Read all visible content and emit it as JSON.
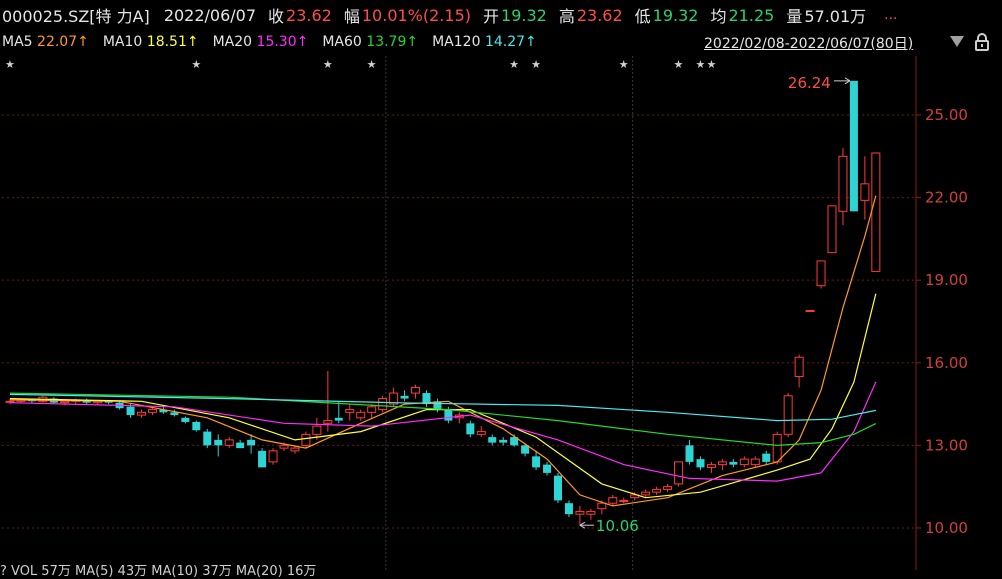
{
  "header": {
    "symbol": "000025.SZ[特 力A]",
    "date": "2022/06/07",
    "close_label": "收",
    "close_value": "23.62",
    "change_label": "幅",
    "change_value": "10.01%(2.15)",
    "open_label": "开",
    "open_value": "19.32",
    "high_label": "高",
    "high_value": "23.62",
    "low_label": "低",
    "low_value": "19.32",
    "avg_label": "均",
    "avg_value": "21.25",
    "volume_label": "量",
    "volume_value": "57.01万",
    "more": "..."
  },
  "ma_legend": [
    {
      "label": "MA5",
      "value": "22.07↑",
      "color": "#ff9a1e"
    },
    {
      "label": "MA10",
      "value": "18.51↑",
      "color": "#ffff3c"
    },
    {
      "label": "MA20",
      "value": "15.30↑",
      "color": "#ff2bff"
    },
    {
      "label": "MA60",
      "value": "13.79↑",
      "color": "#26d826"
    },
    {
      "label": "MA120",
      "value": "14.27↑",
      "color": "#4ce6f0"
    }
  ],
  "date_range": "2022/02/08-2022/06/07(80日)",
  "y_ticks": [
    "25.00",
    "22.00",
    "19.00",
    "16.00",
    "13.00",
    "10.00"
  ],
  "annotations": {
    "high_label": "26.24",
    "low_label": "10.06"
  },
  "volume_bar": {
    "text": "? VOL 57万 MA(5) 43万 MA(10) 37万 MA(20) 16万"
  },
  "colors": {
    "up": "#ff3b3b",
    "down": "#2ed4d4",
    "background": "#000000",
    "grid": "#6b1a1a"
  },
  "chart_data": {
    "type": "candlestick",
    "ylim": [
      9.2,
      26.6
    ],
    "candles": [
      [
        14.6,
        14.7,
        14.5,
        14.6
      ],
      [
        14.6,
        14.7,
        14.55,
        14.65
      ],
      [
        14.65,
        14.7,
        14.55,
        14.6
      ],
      [
        14.6,
        14.8,
        14.55,
        14.75
      ],
      [
        14.7,
        14.75,
        14.5,
        14.55
      ],
      [
        14.55,
        14.65,
        14.45,
        14.6
      ],
      [
        14.6,
        14.7,
        14.5,
        14.65
      ],
      [
        14.65,
        14.7,
        14.5,
        14.55
      ],
      [
        14.55,
        14.65,
        14.45,
        14.6
      ],
      [
        14.6,
        14.65,
        14.5,
        14.55
      ],
      [
        14.55,
        14.6,
        14.3,
        14.35
      ],
      [
        14.4,
        14.5,
        14.0,
        14.1
      ],
      [
        14.1,
        14.3,
        14.0,
        14.2
      ],
      [
        14.2,
        14.35,
        14.1,
        14.3
      ],
      [
        14.3,
        14.4,
        14.15,
        14.2
      ],
      [
        14.2,
        14.3,
        14.05,
        14.1
      ],
      [
        14.0,
        14.05,
        13.8,
        13.85
      ],
      [
        13.85,
        13.9,
        13.5,
        13.55
      ],
      [
        13.5,
        13.6,
        12.9,
        13.0
      ],
      [
        13.2,
        13.4,
        12.6,
        13.0
      ],
      [
        13.0,
        13.3,
        12.9,
        13.2
      ],
      [
        13.1,
        13.2,
        12.9,
        12.9
      ],
      [
        13.2,
        13.4,
        12.7,
        13.0
      ],
      [
        12.8,
        12.9,
        12.2,
        12.2
      ],
      [
        12.4,
        12.9,
        12.3,
        12.8
      ],
      [
        12.9,
        13.1,
        12.8,
        13.0
      ],
      [
        12.8,
        13.0,
        12.7,
        12.9
      ],
      [
        13.0,
        13.5,
        12.9,
        13.4
      ],
      [
        13.4,
        14.0,
        13.2,
        13.7
      ],
      [
        13.8,
        15.7,
        13.5,
        13.9
      ],
      [
        14.0,
        14.6,
        13.8,
        13.9
      ],
      [
        14.2,
        14.5,
        13.9,
        14.3
      ],
      [
        14.0,
        14.3,
        13.9,
        14.2
      ],
      [
        14.2,
        14.5,
        14.0,
        14.4
      ],
      [
        14.3,
        14.8,
        14.2,
        14.7
      ],
      [
        14.5,
        15.1,
        14.4,
        14.9
      ],
      [
        14.8,
        15.0,
        14.6,
        14.7
      ],
      [
        14.9,
        15.2,
        14.7,
        15.1
      ],
      [
        14.9,
        15.0,
        14.4,
        14.5
      ],
      [
        14.6,
        14.7,
        14.2,
        14.3
      ],
      [
        14.3,
        14.4,
        13.8,
        13.9
      ],
      [
        14.0,
        14.2,
        13.8,
        14.1
      ],
      [
        13.8,
        13.9,
        13.3,
        13.4
      ],
      [
        13.4,
        13.7,
        13.3,
        13.5
      ],
      [
        13.3,
        13.4,
        13.0,
        13.1
      ],
      [
        13.2,
        13.3,
        13.0,
        13.1
      ],
      [
        13.3,
        13.4,
        12.95,
        13.0
      ],
      [
        13.0,
        13.05,
        12.6,
        12.7
      ],
      [
        12.6,
        12.8,
        12.1,
        12.2
      ],
      [
        12.3,
        12.4,
        11.9,
        12.0
      ],
      [
        11.9,
        12.0,
        10.9,
        11.0
      ],
      [
        10.9,
        11.0,
        10.4,
        10.5
      ],
      [
        10.5,
        10.8,
        10.1,
        10.6
      ],
      [
        10.5,
        10.7,
        10.3,
        10.6
      ],
      [
        10.7,
        11.0,
        10.5,
        10.9
      ],
      [
        10.9,
        11.2,
        10.8,
        11.1
      ],
      [
        11.0,
        11.1,
        10.9,
        11.0
      ],
      [
        11.1,
        11.3,
        11.0,
        11.2
      ],
      [
        11.2,
        11.4,
        11.1,
        11.3
      ],
      [
        11.3,
        11.5,
        11.2,
        11.4
      ],
      [
        11.4,
        11.6,
        11.3,
        11.5
      ],
      [
        11.6,
        12.4,
        11.5,
        12.4
      ],
      [
        13.0,
        13.2,
        12.3,
        12.4
      ],
      [
        12.5,
        12.6,
        12.1,
        12.2
      ],
      [
        12.2,
        12.4,
        12.0,
        12.3
      ],
      [
        12.3,
        12.5,
        12.1,
        12.4
      ],
      [
        12.4,
        12.5,
        12.2,
        12.3
      ],
      [
        12.3,
        12.6,
        12.2,
        12.5
      ],
      [
        12.3,
        12.6,
        12.2,
        12.5
      ],
      [
        12.7,
        12.8,
        12.3,
        12.4
      ],
      [
        12.4,
        13.5,
        12.3,
        13.4
      ],
      [
        13.4,
        14.9,
        13.3,
        14.8
      ],
      [
        15.5,
        16.3,
        15.1,
        16.2
      ],
      [
        17.9,
        17.9,
        17.9,
        17.9
      ],
      [
        18.8,
        19.7,
        18.7,
        19.7
      ],
      [
        20.0,
        21.7,
        20.0,
        21.7
      ],
      [
        21.5,
        23.8,
        21.0,
        23.5
      ],
      [
        26.24,
        26.24,
        21.5,
        21.5
      ],
      [
        21.9,
        23.5,
        21.2,
        22.5
      ],
      [
        19.32,
        23.62,
        19.32,
        23.62
      ]
    ],
    "ma_series": [
      {
        "name": "MA5",
        "values": [
          [
            0,
            14.65
          ],
          [
            10,
            14.6
          ],
          [
            18,
            14.0
          ],
          [
            23,
            13.2
          ],
          [
            27,
            12.9
          ],
          [
            32,
            13.8
          ],
          [
            36,
            14.5
          ],
          [
            40,
            14.6
          ],
          [
            45,
            13.6
          ],
          [
            49,
            12.5
          ],
          [
            52,
            11.2
          ],
          [
            55,
            10.8
          ],
          [
            60,
            11.1
          ],
          [
            65,
            11.9
          ],
          [
            70,
            12.4
          ],
          [
            72,
            13.2
          ],
          [
            74,
            15.0
          ],
          [
            76,
            18.0
          ],
          [
            78,
            20.6
          ],
          [
            79,
            22.07
          ]
        ]
      },
      {
        "name": "MA10",
        "values": [
          [
            0,
            14.7
          ],
          [
            12,
            14.6
          ],
          [
            20,
            14.0
          ],
          [
            26,
            13.2
          ],
          [
            32,
            13.5
          ],
          [
            38,
            14.3
          ],
          [
            42,
            14.3
          ],
          [
            48,
            13.3
          ],
          [
            54,
            11.6
          ],
          [
            58,
            11.1
          ],
          [
            63,
            11.3
          ],
          [
            70,
            12.1
          ],
          [
            73,
            12.5
          ],
          [
            75,
            13.6
          ],
          [
            77,
            15.3
          ],
          [
            79,
            18.51
          ]
        ]
      },
      {
        "name": "MA20",
        "values": [
          [
            0,
            14.55
          ],
          [
            15,
            14.4
          ],
          [
            25,
            13.8
          ],
          [
            33,
            13.7
          ],
          [
            42,
            14.1
          ],
          [
            50,
            13.2
          ],
          [
            56,
            12.3
          ],
          [
            62,
            11.8
          ],
          [
            70,
            11.7
          ],
          [
            74,
            12.0
          ],
          [
            77,
            13.5
          ],
          [
            79,
            15.3
          ]
        ]
      },
      {
        "name": "MA60",
        "values": [
          [
            0,
            14.9
          ],
          [
            20,
            14.75
          ],
          [
            40,
            14.3
          ],
          [
            50,
            13.9
          ],
          [
            60,
            13.4
          ],
          [
            70,
            13.0
          ],
          [
            74,
            13.1
          ],
          [
            77,
            13.4
          ],
          [
            79,
            13.79
          ]
        ]
      },
      {
        "name": "MA120",
        "values": [
          [
            0,
            14.85
          ],
          [
            20,
            14.7
          ],
          [
            35,
            14.55
          ],
          [
            50,
            14.45
          ],
          [
            60,
            14.2
          ],
          [
            70,
            13.9
          ],
          [
            75,
            13.95
          ],
          [
            79,
            14.27
          ]
        ]
      }
    ],
    "star_markers": [
      0,
      17,
      29,
      33,
      46,
      48,
      56,
      61,
      63,
      64
    ],
    "high_index": 77,
    "low_index": 52
  }
}
